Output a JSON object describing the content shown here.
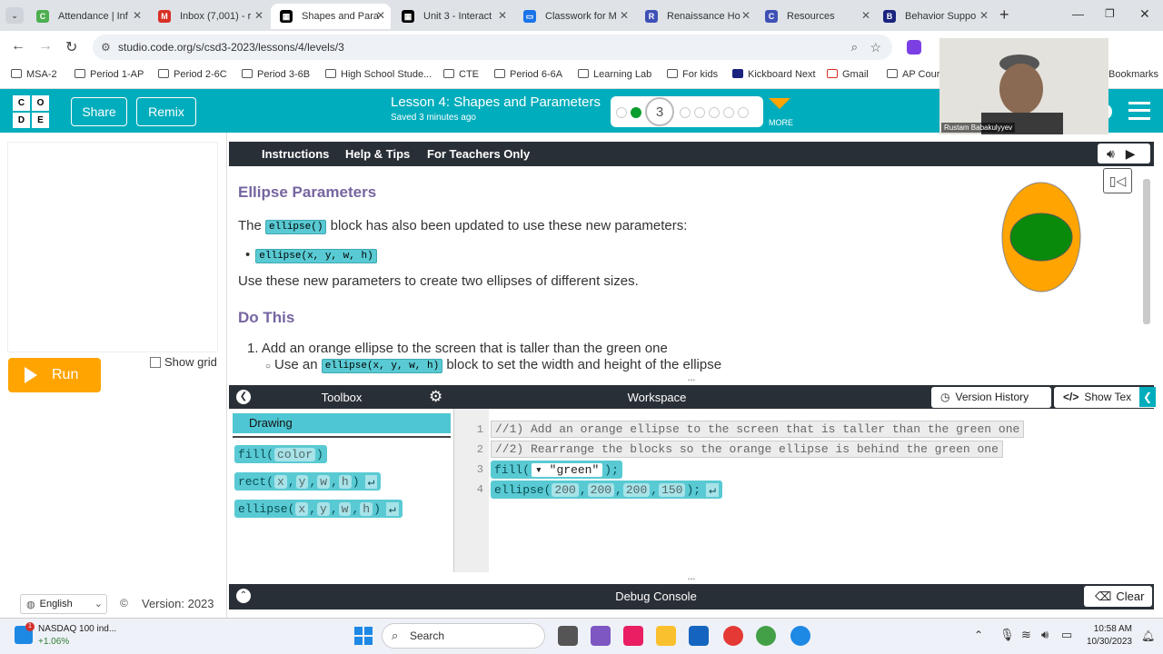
{
  "browser": {
    "tabs": [
      {
        "label": "Attendance | Inf",
        "icon": "c-icon",
        "color": "#4caf50"
      },
      {
        "label": "Inbox (7,001) - r",
        "icon": "gmail-icon",
        "color": "#d93025"
      },
      {
        "label": "Shapes and Para",
        "icon": "grid-icon",
        "color": "#000000"
      },
      {
        "label": "Unit 3 - Interact",
        "icon": "grid-icon",
        "color": "#000000"
      },
      {
        "label": "Classwork for M",
        "icon": "classroom-icon",
        "color": "#1a73e8"
      },
      {
        "label": "Renaissance Ho",
        "icon": "r-icon",
        "color": "#3f51b5"
      },
      {
        "label": "Resources",
        "icon": "c-icon",
        "color": "#3f51b5"
      },
      {
        "label": "Behavior Suppo",
        "icon": "behavior-icon",
        "color": "#1a237e"
      }
    ],
    "url": "studio.code.org/s/csd3-2023/lessons/4/levels/3",
    "bookmarks": [
      "MSA-2",
      "Period 1-AP",
      "Period 2-6C",
      "Period 3-6B",
      "High School Stude...",
      "CTE",
      "Period 6-6A",
      "Learning Lab",
      "For kids",
      "Kickboard Next",
      "Gmail",
      "AP Cours"
    ],
    "bookmarks_right": "Bookmarks"
  },
  "header": {
    "logo_letters": [
      "C",
      "O",
      "D",
      "E"
    ],
    "share": "Share",
    "remix": "Remix",
    "lesson_title": "Lesson 4: Shapes and Parameters",
    "saved": "Saved 3 minutes ago",
    "current_level": "3",
    "more": "MORE"
  },
  "video": {
    "name": "Rustam Babakulyyev"
  },
  "left": {
    "run": "Run",
    "show_grid": "Show grid",
    "language": "English",
    "version": "Version: 2023"
  },
  "instructions": {
    "tabs": [
      "Instructions",
      "Help & Tips",
      "For Teachers Only"
    ],
    "heading1": "Ellipse Parameters",
    "line1_pre": "The",
    "line1_code": "ellipse()",
    "line1_post": "block has also been updated to use these new parameters:",
    "bullet_code": "ellipse(x, y, w, h)",
    "line2": "Use these new parameters to create two ellipses of different sizes.",
    "heading2": "Do This",
    "step1": "1. Add an orange ellipse to the screen that is taller than the green one",
    "step1_sub_pre": "Use an",
    "step1_sub_code": "ellipse(x, y, w, h)",
    "step1_sub_post": "block to set the width and height of the ellipse"
  },
  "toolbox": {
    "title": "Toolbox",
    "category": "Drawing",
    "blocks": [
      {
        "name": "fill",
        "params": [
          "color"
        ],
        "enter": false
      },
      {
        "name": "rect",
        "params": [
          "x",
          "y",
          "w",
          "h"
        ],
        "enter": true
      },
      {
        "name": "ellipse",
        "params": [
          "x",
          "y",
          "w",
          "h"
        ],
        "enter": true
      }
    ]
  },
  "workspace": {
    "title": "Workspace",
    "version_history": "Version History",
    "show_text": "Show Tex",
    "lines": [
      {
        "num": "1",
        "text": "//1) Add an orange ellipse to the screen that is taller than the green one"
      },
      {
        "num": "2",
        "text": "//2) Rearrange the blocks so the orange ellipse is behind the green one"
      },
      {
        "num": "3",
        "fn": "fill",
        "arg": "\"green\""
      },
      {
        "num": "4",
        "fn": "ellipse",
        "args": [
          "200",
          "200",
          "200",
          "150"
        ]
      }
    ]
  },
  "debug": {
    "title": "Debug Console",
    "clear": "Clear"
  },
  "taskbar": {
    "stock_name": "NASDAQ 100 ind...",
    "stock_change": "+1.06%",
    "search": "Search",
    "time": "10:58 AM",
    "date": "10/30/2023"
  },
  "colors": {
    "teal": "#00adbc",
    "run": "#ffa400",
    "block": "#59cad3",
    "orange": "#ffa400",
    "green": "#0a8a0a"
  }
}
